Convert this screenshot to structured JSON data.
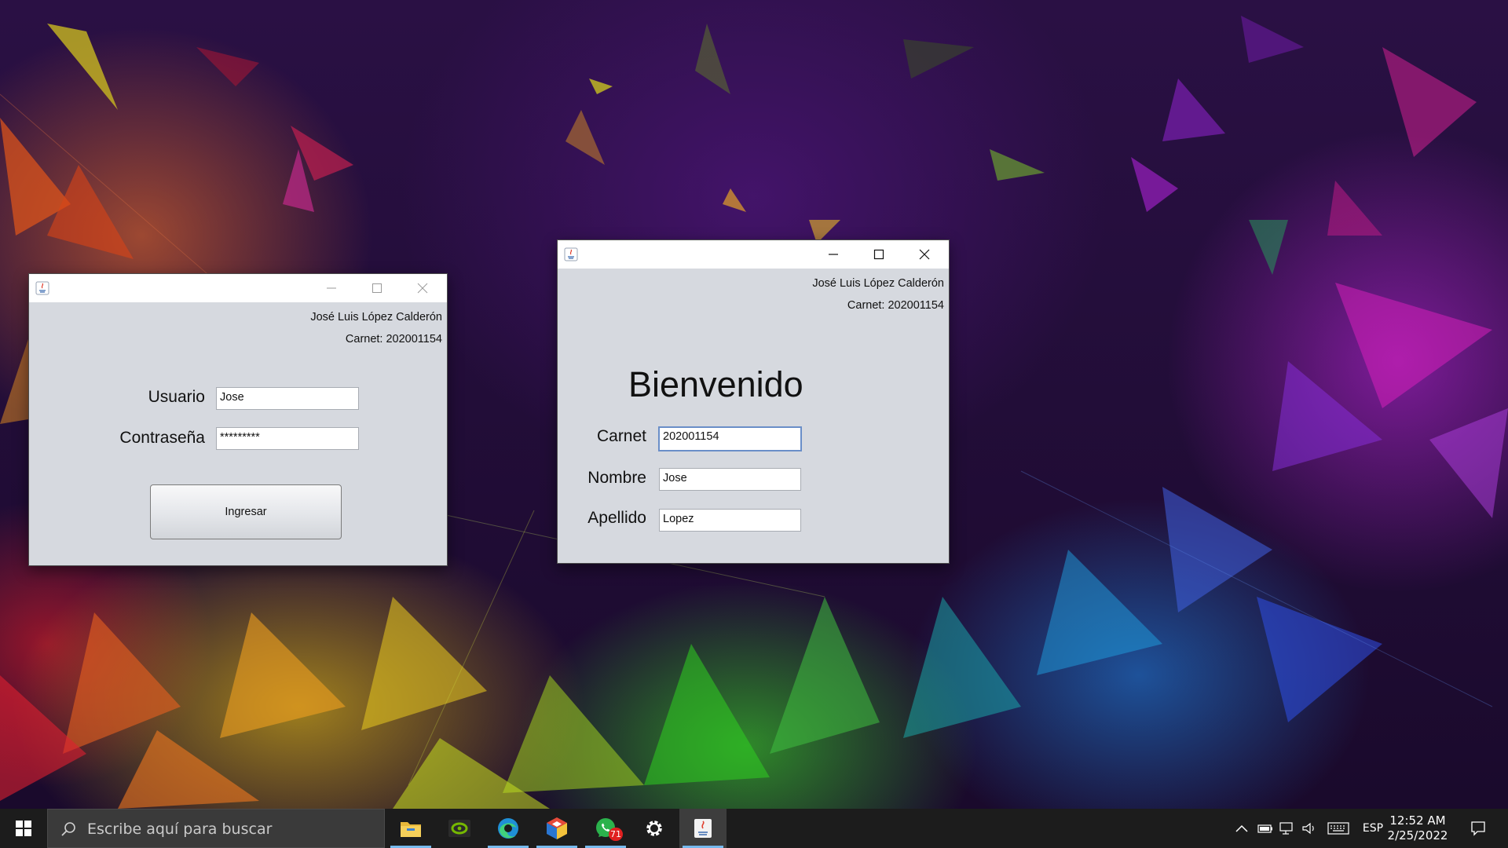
{
  "login_window": {
    "author_name": "José Luis López Calderón",
    "author_carnet": "Carnet: 202001154",
    "usuario_label": "Usuario",
    "usuario_value": "Jose",
    "contrasena_label": "Contraseña",
    "contrasena_value": "*********",
    "ingresar_label": "Ingresar"
  },
  "welcome_window": {
    "author_name": "José Luis López Calderón",
    "author_carnet": "Carnet: 202001154",
    "heading": "Bienvenido",
    "carnet_label": "Carnet",
    "carnet_value": "202001154",
    "nombre_label": "Nombre",
    "nombre_value": "Jose",
    "apellido_label": "Apellido",
    "apellido_value": "Lopez"
  },
  "taskbar": {
    "search_placeholder": "Escribe aquí para buscar",
    "apps": [
      "file-explorer",
      "nvidia",
      "edge",
      "cube-app",
      "whatsapp",
      "settings",
      "java"
    ],
    "whatsapp_badge": "71",
    "language": "ESP",
    "time": "12:52 AM",
    "date": "2/25/2022"
  },
  "colors": {
    "window_bg": "#d6d9df",
    "taskbar_bg": "#1c1c1c",
    "focus_border": "#6a8ec8"
  }
}
